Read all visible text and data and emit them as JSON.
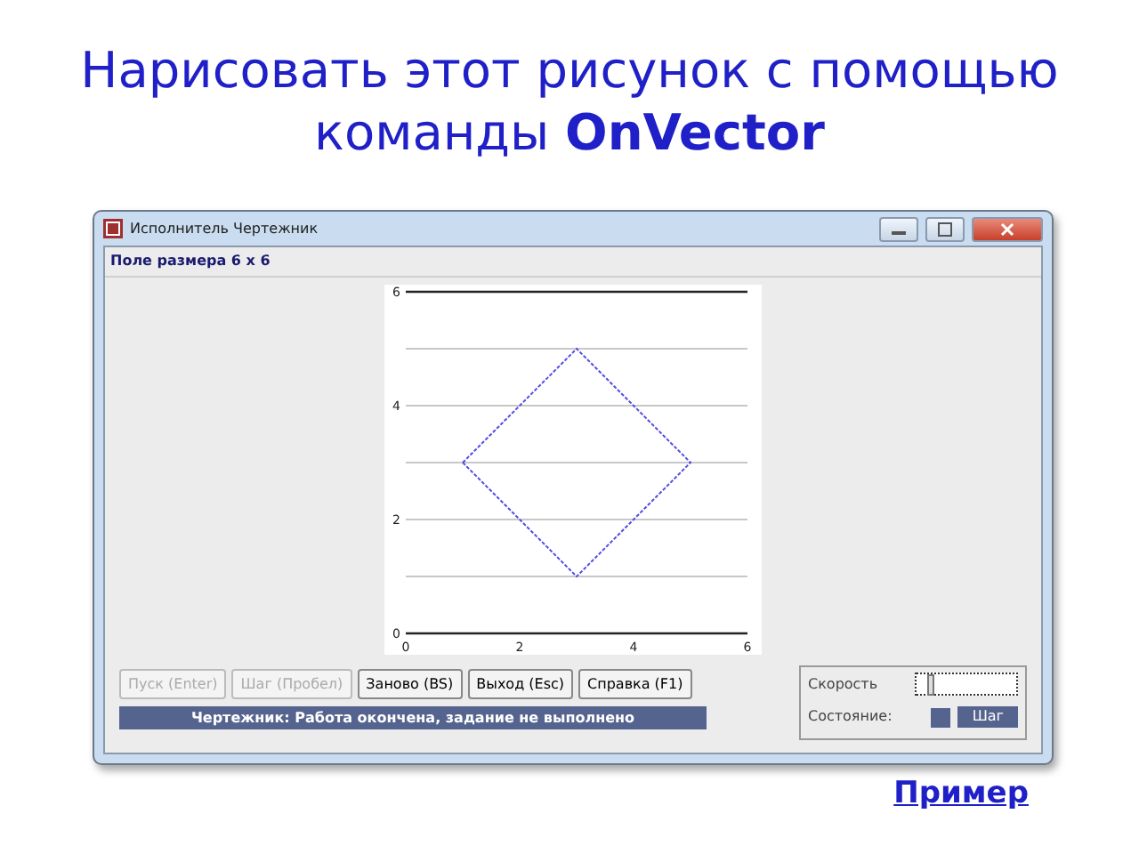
{
  "slide_title": "Нарисовать этот рисунок с помощью команды **OnVector**",
  "window": {
    "title": "Исполнитель Чертежник",
    "field_label": "Поле размера 6 x 6",
    "field": {
      "x_ticks": [
        "0",
        "2",
        "4",
        "6"
      ],
      "y_ticks": [
        "6",
        "4",
        "2",
        "0"
      ]
    },
    "buttons": [
      {
        "label": "Пуск (Enter)",
        "disabled": true
      },
      {
        "label": "Шаг (Пробел)",
        "disabled": true
      },
      {
        "label": "Заново (BS)",
        "disabled": false
      },
      {
        "label": "Выход (Esc)",
        "disabled": false
      },
      {
        "label": "Справка (F1)",
        "disabled": false
      }
    ],
    "status": "Чертежник: Работа окончена, задание не выполнено",
    "speed_label": "Скорость",
    "speed": {
      "level": 0.12
    },
    "state_label": "Состояние:",
    "step_button": "Шаг"
  },
  "link": "Пример"
}
